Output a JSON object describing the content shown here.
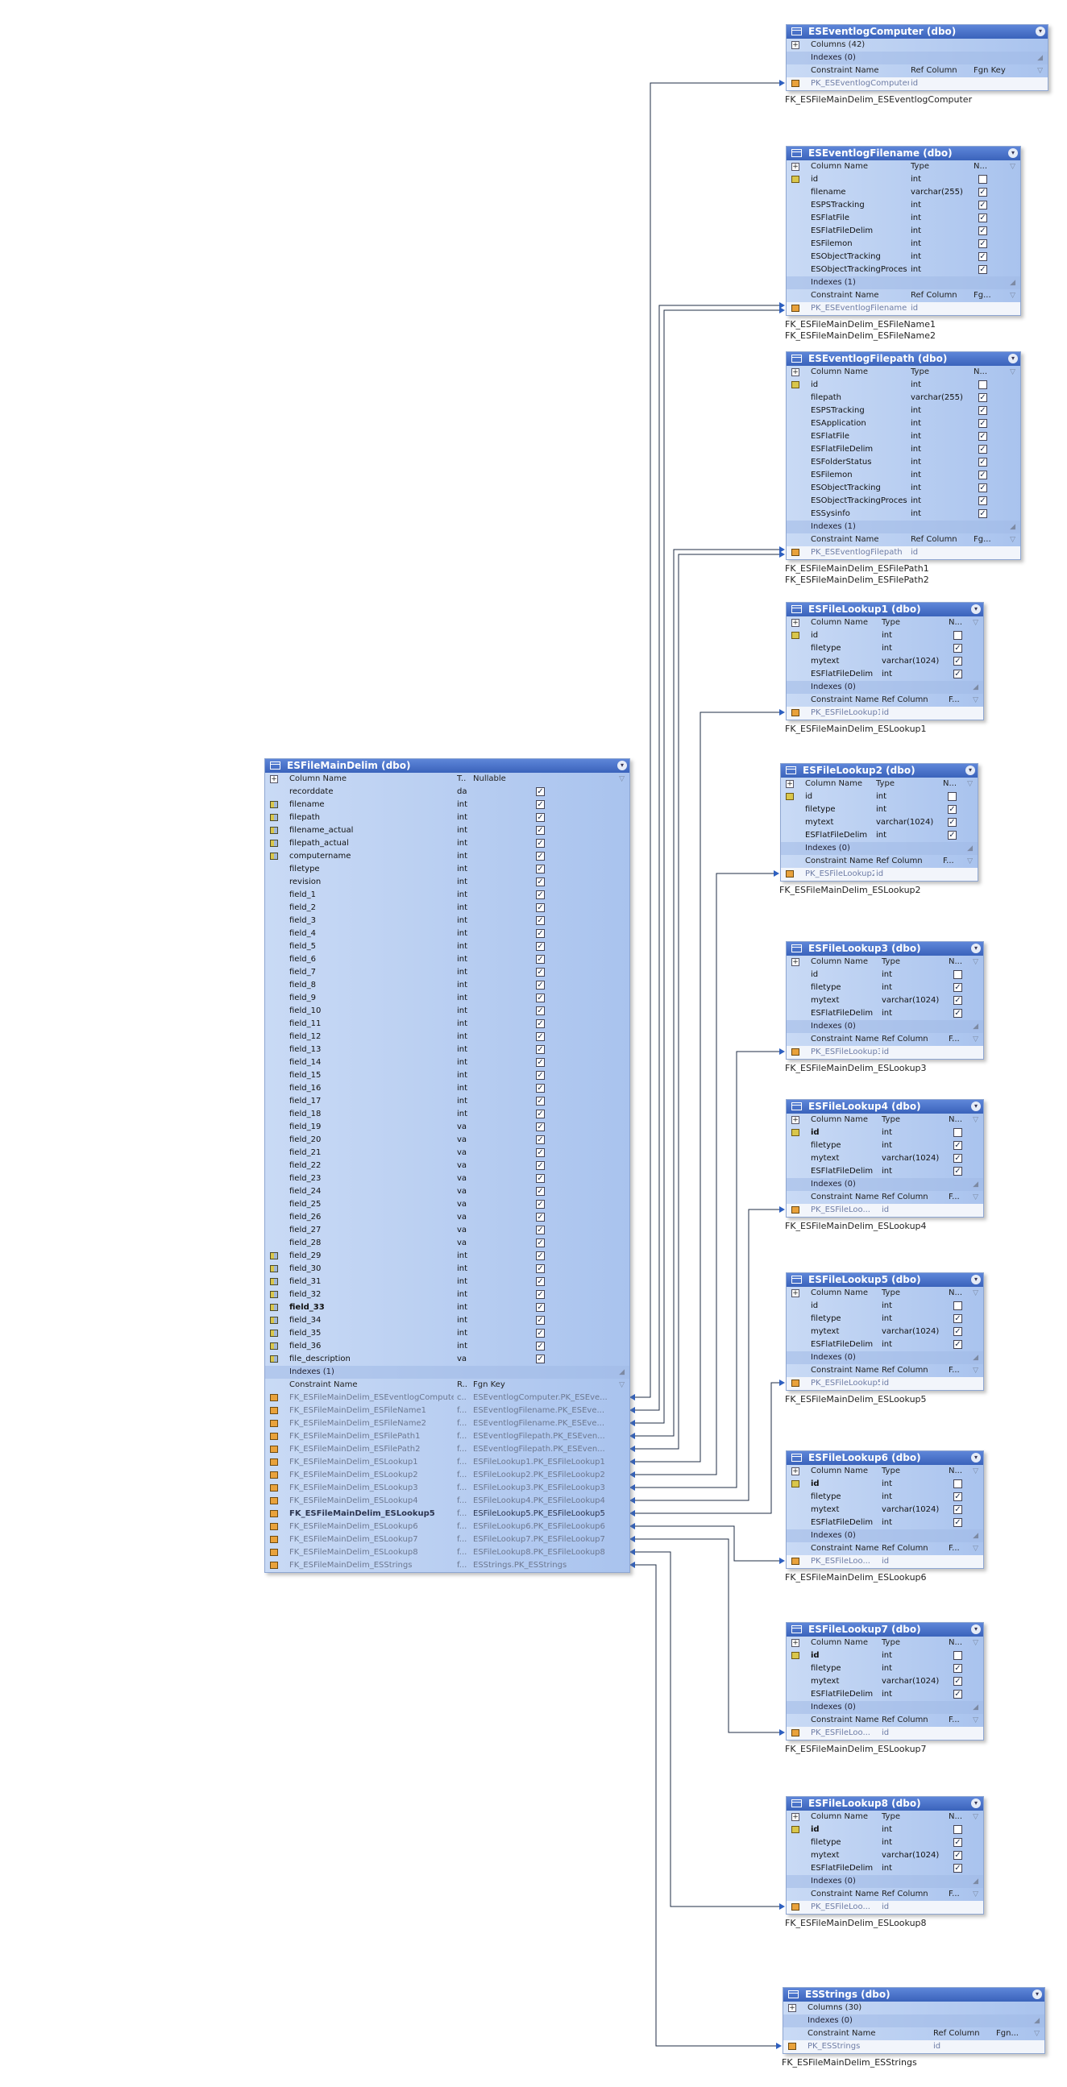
{
  "diagram": {
    "line_color": "#1f2d44",
    "header_color": "#3f67c0",
    "body_color": "#b7cdf0",
    "main_table": {
      "title": "ESFileMainDelim (dbo)",
      "col_headers": [
        "Column Name",
        "T..",
        "Nullable"
      ],
      "columns": [
        {
          "name": "recorddate",
          "type": "da",
          "key": ""
        },
        {
          "name": "filename",
          "type": "int",
          "key": "fk"
        },
        {
          "name": "filepath",
          "type": "int",
          "key": "fk"
        },
        {
          "name": "filename_actual",
          "type": "int",
          "key": "fk"
        },
        {
          "name": "filepath_actual",
          "type": "int",
          "key": "fk"
        },
        {
          "name": "computername",
          "type": "int",
          "key": "fk"
        },
        {
          "name": "filetype",
          "type": "int",
          "key": ""
        },
        {
          "name": "revision",
          "type": "int",
          "key": ""
        },
        {
          "name": "field_1",
          "type": "int",
          "key": ""
        },
        {
          "name": "field_2",
          "type": "int",
          "key": ""
        },
        {
          "name": "field_3",
          "type": "int",
          "key": ""
        },
        {
          "name": "field_4",
          "type": "int",
          "key": ""
        },
        {
          "name": "field_5",
          "type": "int",
          "key": ""
        },
        {
          "name": "field_6",
          "type": "int",
          "key": ""
        },
        {
          "name": "field_7",
          "type": "int",
          "key": ""
        },
        {
          "name": "field_8",
          "type": "int",
          "key": ""
        },
        {
          "name": "field_9",
          "type": "int",
          "key": ""
        },
        {
          "name": "field_10",
          "type": "int",
          "key": ""
        },
        {
          "name": "field_11",
          "type": "int",
          "key": ""
        },
        {
          "name": "field_12",
          "type": "int",
          "key": ""
        },
        {
          "name": "field_13",
          "type": "int",
          "key": ""
        },
        {
          "name": "field_14",
          "type": "int",
          "key": ""
        },
        {
          "name": "field_15",
          "type": "int",
          "key": ""
        },
        {
          "name": "field_16",
          "type": "int",
          "key": ""
        },
        {
          "name": "field_17",
          "type": "int",
          "key": ""
        },
        {
          "name": "field_18",
          "type": "int",
          "key": ""
        },
        {
          "name": "field_19",
          "type": "va",
          "key": ""
        },
        {
          "name": "field_20",
          "type": "va",
          "key": ""
        },
        {
          "name": "field_21",
          "type": "va",
          "key": ""
        },
        {
          "name": "field_22",
          "type": "va",
          "key": ""
        },
        {
          "name": "field_23",
          "type": "va",
          "key": ""
        },
        {
          "name": "field_24",
          "type": "va",
          "key": ""
        },
        {
          "name": "field_25",
          "type": "va",
          "key": ""
        },
        {
          "name": "field_26",
          "type": "va",
          "key": ""
        },
        {
          "name": "field_27",
          "type": "va",
          "key": ""
        },
        {
          "name": "field_28",
          "type": "va",
          "key": ""
        },
        {
          "name": "field_29",
          "type": "int",
          "key": "fk"
        },
        {
          "name": "field_30",
          "type": "int",
          "key": "fk"
        },
        {
          "name": "field_31",
          "type": "int",
          "key": "fk"
        },
        {
          "name": "field_32",
          "type": "int",
          "key": "fk"
        },
        {
          "name": "field_33",
          "type": "int",
          "key": "fk",
          "bold": true
        },
        {
          "name": "field_34",
          "type": "int",
          "key": "fk"
        },
        {
          "name": "field_35",
          "type": "int",
          "key": "fk"
        },
        {
          "name": "field_36",
          "type": "int",
          "key": "fk"
        },
        {
          "name": "file_description",
          "type": "va",
          "key": "fk"
        }
      ],
      "indexes_label": "Indexes (1)",
      "cons_headers": [
        "Constraint Name",
        "R..",
        "Fgn Key"
      ],
      "constraints": [
        {
          "name": "FK_ESFileMainDelim_ESEventlogComputer",
          "ref": "c..",
          "fgn": "ESEventlogComputer.PK_ESEve..."
        },
        {
          "name": "FK_ESFileMainDelim_ESFileName1",
          "ref": "f...",
          "fgn": "ESEventlogFilename.PK_ESEve..."
        },
        {
          "name": "FK_ESFileMainDelim_ESFileName2",
          "ref": "f...",
          "fgn": "ESEventlogFilename.PK_ESEve..."
        },
        {
          "name": "FK_ESFileMainDelim_ESFilePath1",
          "ref": "f...",
          "fgn": "ESEventlogFilepath.PK_ESEven..."
        },
        {
          "name": "FK_ESFileMainDelim_ESFilePath2",
          "ref": "f...",
          "fgn": "ESEventlogFilepath.PK_ESEven..."
        },
        {
          "name": "FK_ESFileMainDelim_ESLookup1",
          "ref": "f...",
          "fgn": "ESFileLookup1.PK_ESFileLookup1"
        },
        {
          "name": "FK_ESFileMainDelim_ESLookup2",
          "ref": "f...",
          "fgn": "ESFileLookup2.PK_ESFileLookup2"
        },
        {
          "name": "FK_ESFileMainDelim_ESLookup3",
          "ref": "f...",
          "fgn": "ESFileLookup3.PK_ESFileLookup3"
        },
        {
          "name": "FK_ESFileMainDelim_ESLookup4",
          "ref": "f...",
          "fgn": "ESFileLookup4.PK_ESFileLookup4"
        },
        {
          "name": "FK_ESFileMainDelim_ESLookup5",
          "ref": "f...",
          "fgn": "ESFileLookup5.PK_ESFileLookup5",
          "bold": true
        },
        {
          "name": "FK_ESFileMainDelim_ESLookup6",
          "ref": "f...",
          "fgn": "ESFileLookup6.PK_ESFileLookup6"
        },
        {
          "name": "FK_ESFileMainDelim_ESLookup7",
          "ref": "f...",
          "fgn": "ESFileLookup7.PK_ESFileLookup7"
        },
        {
          "name": "FK_ESFileMainDelim_ESLookup8",
          "ref": "f...",
          "fgn": "ESFileLookup8.PK_ESFileLookup8"
        },
        {
          "name": "FK_ESFileMainDelim_ESStrings",
          "ref": "f...",
          "fgn": "ESStrings.PK_ESStrings"
        }
      ]
    },
    "tables": [
      {
        "title": "ESEventlogComputer (dbo)",
        "icon": "computer",
        "summary": [
          "Columns (42)",
          "Indexes (0)"
        ],
        "cons_headers": [
          "Constraint Name",
          "Ref Column",
          "Fgn Key"
        ],
        "pk": {
          "name": "PK_ESEventlogComputer",
          "col": "id"
        },
        "fk_labels": [
          "FK_ESFileMainDelim_ESEventlogComputer"
        ]
      },
      {
        "title": "ESEventlogFilename (dbo)",
        "col_headers": [
          "Column Name",
          "Type",
          "N..."
        ],
        "columns": [
          {
            "name": "id",
            "type": "int",
            "key": "pk",
            "checked": false
          },
          {
            "name": "filename",
            "type": "varchar(255)",
            "checked": true
          },
          {
            "name": "ESPSTracking",
            "type": "int",
            "checked": true
          },
          {
            "name": "ESFlatFile",
            "type": "int",
            "checked": true
          },
          {
            "name": "ESFlatFileDelim",
            "type": "int",
            "checked": true
          },
          {
            "name": "ESFilemon",
            "type": "int",
            "checked": true
          },
          {
            "name": "ESObjectTracking",
            "type": "int",
            "checked": true
          },
          {
            "name": "ESObjectTrackingProcess",
            "type": "int",
            "checked": true
          }
        ],
        "indexes_label": "Indexes (1)",
        "cons_headers": [
          "Constraint Name",
          "Ref Column",
          "Fg..."
        ],
        "pk": {
          "name": "PK_ESEventlogFilename",
          "col": "id"
        },
        "fk_labels": [
          "FK_ESFileMainDelim_ESFileName1",
          "FK_ESFileMainDelim_ESFileName2"
        ]
      },
      {
        "title": "ESEventlogFilepath (dbo)",
        "col_headers": [
          "Column Name",
          "Type",
          "N..."
        ],
        "columns": [
          {
            "name": "id",
            "type": "int",
            "key": "pk",
            "checked": false
          },
          {
            "name": "filepath",
            "type": "varchar(255)",
            "checked": true
          },
          {
            "name": "ESPSTracking",
            "type": "int",
            "checked": true
          },
          {
            "name": "ESApplication",
            "type": "int",
            "checked": true
          },
          {
            "name": "ESFlatFile",
            "type": "int",
            "checked": true
          },
          {
            "name": "ESFlatFileDelim",
            "type": "int",
            "checked": true
          },
          {
            "name": "ESFolderStatus",
            "type": "int",
            "checked": true
          },
          {
            "name": "ESFilemon",
            "type": "int",
            "checked": true
          },
          {
            "name": "ESObjectTracking",
            "type": "int",
            "checked": true
          },
          {
            "name": "ESObjectTrackingProcess",
            "type": "int",
            "checked": true
          },
          {
            "name": "ESSysinfo",
            "type": "int",
            "checked": true
          }
        ],
        "indexes_label": "Indexes (1)",
        "cons_headers": [
          "Constraint Name",
          "Ref Column",
          "Fg..."
        ],
        "pk": {
          "name": "PK_ESEventlogFilepath",
          "col": "id"
        },
        "fk_labels": [
          "FK_ESFileMainDelim_ESFilePath1",
          "FK_ESFileMainDelim_ESFilePath2"
        ]
      },
      {
        "title": "ESFileLookup1 (dbo)",
        "col_headers": [
          "Column Name",
          "Type",
          "N..."
        ],
        "columns": [
          {
            "name": "id",
            "type": "int",
            "key": "pk",
            "checked": false
          },
          {
            "name": "filetype",
            "type": "int",
            "checked": true
          },
          {
            "name": "mytext",
            "type": "varchar(1024)",
            "checked": true
          },
          {
            "name": "ESFlatFileDelim",
            "type": "int",
            "checked": true
          }
        ],
        "indexes_label": "Indexes (0)",
        "cons_headers": [
          "Constraint Name",
          "Ref Column",
          "F..."
        ],
        "pk": {
          "name": "PK_ESFileLookup1",
          "col": "id"
        },
        "fk_labels": [
          "FK_ESFileMainDelim_ESLookup1"
        ]
      },
      {
        "title": "ESFileLookup2 (dbo)",
        "col_headers": [
          "Column Name",
          "Type",
          "N..."
        ],
        "columns": [
          {
            "name": "id",
            "type": "int",
            "key": "pk",
            "checked": false
          },
          {
            "name": "filetype",
            "type": "int",
            "checked": true
          },
          {
            "name": "mytext",
            "type": "varchar(1024)",
            "checked": true
          },
          {
            "name": "ESFlatFileDelim",
            "type": "int",
            "checked": true
          }
        ],
        "indexes_label": "Indexes (0)",
        "cons_headers": [
          "Constraint Name",
          "Ref Column",
          "F..."
        ],
        "pk": {
          "name": "PK_ESFileLookup2",
          "col": "id"
        },
        "fk_labels": [
          "FK_ESFileMainDelim_ESLookup2"
        ]
      },
      {
        "title": "ESFileLookup3 (dbo)",
        "col_headers": [
          "Column Name",
          "Type",
          "N..."
        ],
        "columns": [
          {
            "name": "id",
            "type": "int",
            "key": "",
            "checked": false
          },
          {
            "name": "filetype",
            "type": "int",
            "checked": true
          },
          {
            "name": "mytext",
            "type": "varchar(1024)",
            "checked": true
          },
          {
            "name": "ESFlatFileDelim",
            "type": "int",
            "checked": true
          }
        ],
        "indexes_label": "Indexes (0)",
        "cons_headers": [
          "Constraint Name",
          "Ref Column",
          "F..."
        ],
        "pk": {
          "name": "PK_ESFileLookup3",
          "col": "id"
        },
        "fk_labels": [
          "FK_ESFileMainDelim_ESLookup3"
        ]
      },
      {
        "title": "ESFileLookup4 (dbo)",
        "col_headers": [
          "Column Name",
          "Type",
          "N..."
        ],
        "columns": [
          {
            "name": "id",
            "type": "int",
            "key": "pk",
            "checked": false,
            "bold": true
          },
          {
            "name": "filetype",
            "type": "int",
            "checked": true
          },
          {
            "name": "mytext",
            "type": "varchar(1024)",
            "checked": true
          },
          {
            "name": "ESFlatFileDelim",
            "type": "int",
            "checked": true
          }
        ],
        "indexes_label": "Indexes (0)",
        "cons_headers": [
          "Constraint Name",
          "Ref Column",
          "F..."
        ],
        "pk": {
          "name": "PK_ESFileLoo...",
          "col": "id"
        },
        "fk_labels": [
          "FK_ESFileMainDelim_ESLookup4"
        ]
      },
      {
        "title": "ESFileLookup5 (dbo)",
        "col_headers": [
          "Column Name",
          "Type",
          "N..."
        ],
        "columns": [
          {
            "name": "id",
            "type": "int",
            "key": "",
            "checked": false
          },
          {
            "name": "filetype",
            "type": "int",
            "checked": true
          },
          {
            "name": "mytext",
            "type": "varchar(1024)",
            "checked": true
          },
          {
            "name": "ESFlatFileDelim",
            "type": "int",
            "checked": true
          }
        ],
        "indexes_label": "Indexes (0)",
        "cons_headers": [
          "Constraint Name",
          "Ref Column",
          "F..."
        ],
        "pk": {
          "name": "PK_ESFileLookup5",
          "col": "id"
        },
        "fk_labels": [
          "FK_ESFileMainDelim_ESLookup5"
        ]
      },
      {
        "title": "ESFileLookup6 (dbo)",
        "col_headers": [
          "Column Name",
          "Type",
          "N..."
        ],
        "columns": [
          {
            "name": "id",
            "type": "int",
            "key": "pk",
            "checked": false,
            "bold": true
          },
          {
            "name": "filetype",
            "type": "int",
            "checked": true
          },
          {
            "name": "mytext",
            "type": "varchar(1024)",
            "checked": true
          },
          {
            "name": "ESFlatFileDelim",
            "type": "int",
            "checked": true
          }
        ],
        "indexes_label": "Indexes (0)",
        "cons_headers": [
          "Constraint Name",
          "Ref Column",
          "F..."
        ],
        "pk": {
          "name": "PK_ESFileLoo...",
          "col": "id"
        },
        "fk_labels": [
          "FK_ESFileMainDelim_ESLookup6"
        ]
      },
      {
        "title": "ESFileLookup7 (dbo)",
        "col_headers": [
          "Column Name",
          "Type",
          "N..."
        ],
        "columns": [
          {
            "name": "id",
            "type": "int",
            "key": "pk",
            "checked": false,
            "bold": true
          },
          {
            "name": "filetype",
            "type": "int",
            "checked": true
          },
          {
            "name": "mytext",
            "type": "varchar(1024)",
            "checked": true
          },
          {
            "name": "ESFlatFileDelim",
            "type": "int",
            "checked": true
          }
        ],
        "indexes_label": "Indexes (0)",
        "cons_headers": [
          "Constraint Name",
          "Ref Column",
          "F..."
        ],
        "pk": {
          "name": "PK_ESFileLoo...",
          "col": "id"
        },
        "fk_labels": [
          "FK_ESFileMainDelim_ESLookup7"
        ]
      },
      {
        "title": "ESFileLookup8 (dbo)",
        "col_headers": [
          "Column Name",
          "Type",
          "N..."
        ],
        "columns": [
          {
            "name": "id",
            "type": "int",
            "key": "pk",
            "checked": false,
            "bold": true
          },
          {
            "name": "filetype",
            "type": "int",
            "checked": true
          },
          {
            "name": "mytext",
            "type": "varchar(1024)",
            "checked": true
          },
          {
            "name": "ESFlatFileDelim",
            "type": "int",
            "checked": true
          }
        ],
        "indexes_label": "Indexes (0)",
        "cons_headers": [
          "Constraint Name",
          "Ref Column",
          "F..."
        ],
        "pk": {
          "name": "PK_ESFileLoo...",
          "col": "id"
        },
        "fk_labels": [
          "FK_ESFileMainDelim_ESLookup8"
        ]
      },
      {
        "title": "ESStrings (dbo)",
        "summary": [
          "Columns (30)",
          "Indexes (0)"
        ],
        "cons_headers": [
          "Constraint Name",
          "Ref Column",
          "Fgn..."
        ],
        "pk": {
          "name": "PK_ESStrings",
          "col": "id"
        },
        "fk_labels": [
          "FK_ESFileMainDelim_ESStrings"
        ]
      }
    ]
  }
}
